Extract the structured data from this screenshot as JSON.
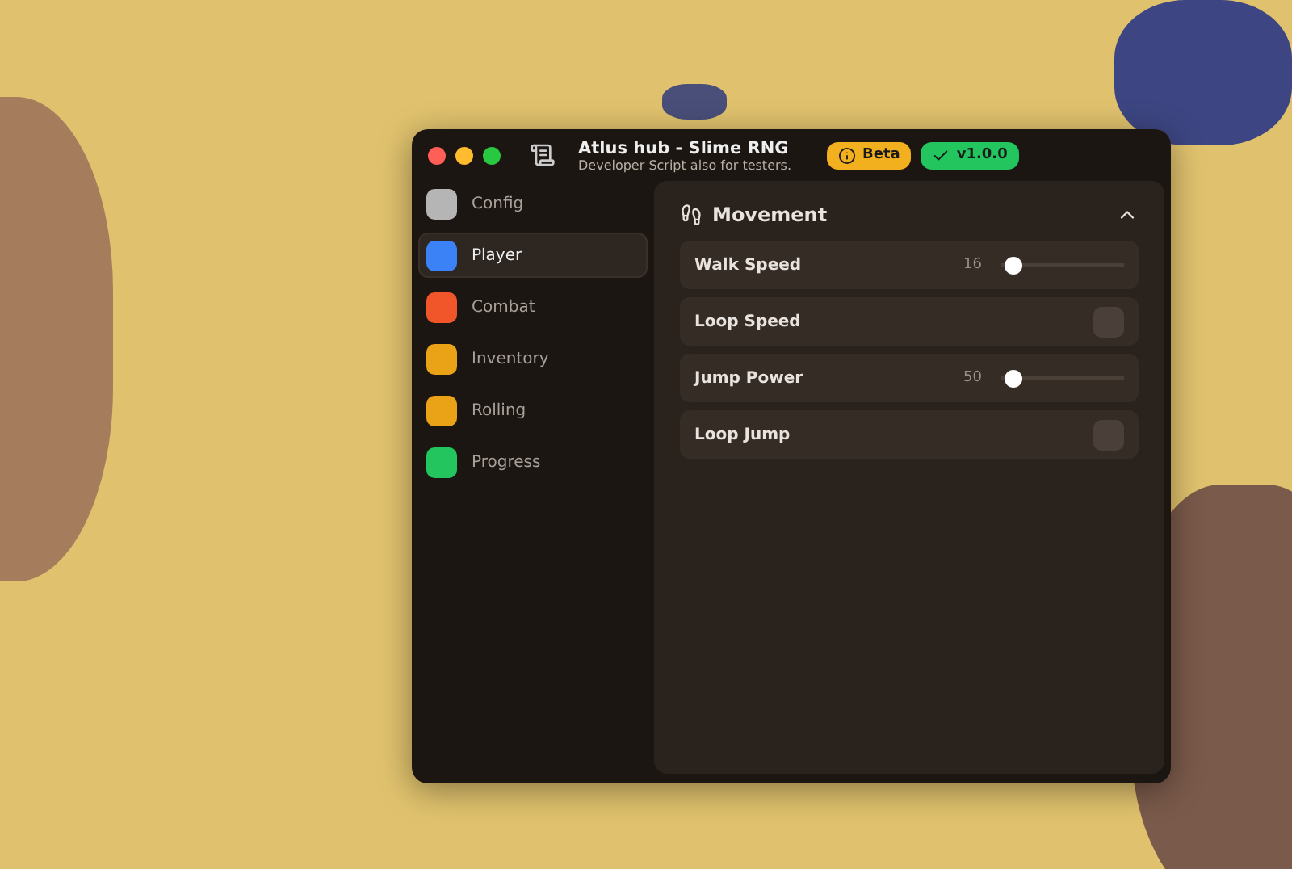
{
  "window": {
    "title": "Atlus hub - Slime RNG",
    "subtitle": "Developer Script also for testers."
  },
  "badges": [
    {
      "kind": "info",
      "label": "Beta",
      "color": "#f2b01e"
    },
    {
      "kind": "check",
      "label": "v1.0.0",
      "color": "#22c55e"
    }
  ],
  "sidebar": {
    "items": [
      {
        "label": "Config",
        "color": "#b5b5b5",
        "selected": false
      },
      {
        "label": "Player",
        "color": "#3b82f6",
        "selected": true
      },
      {
        "label": "Combat",
        "color": "#f0562a",
        "selected": false
      },
      {
        "label": "Inventory",
        "color": "#eaa317",
        "selected": false
      },
      {
        "label": "Rolling",
        "color": "#eaa317",
        "selected": false
      },
      {
        "label": "Progress",
        "color": "#22c55e",
        "selected": false
      }
    ]
  },
  "section": {
    "title": "Movement",
    "expanded": true,
    "rows": [
      {
        "kind": "slider",
        "label": "Walk Speed",
        "reading": "16",
        "level": 0.03
      },
      {
        "kind": "toggle",
        "label": "Loop Speed",
        "on": false
      },
      {
        "kind": "slider",
        "label": "Jump Power",
        "reading": "50",
        "level": 0.03
      },
      {
        "kind": "toggle",
        "label": "Loop Jump",
        "on": false
      }
    ]
  }
}
